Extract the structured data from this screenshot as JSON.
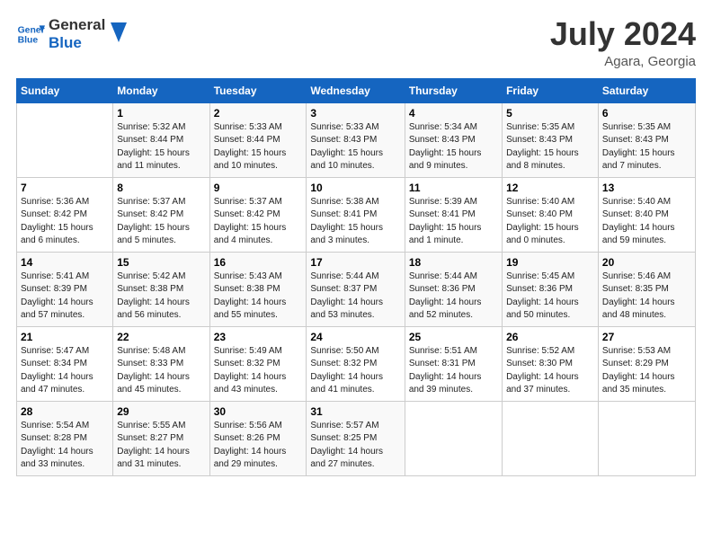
{
  "header": {
    "logo_line1": "General",
    "logo_line2": "Blue",
    "month": "July 2024",
    "location": "Agara, Georgia"
  },
  "days_of_week": [
    "Sunday",
    "Monday",
    "Tuesday",
    "Wednesday",
    "Thursday",
    "Friday",
    "Saturday"
  ],
  "weeks": [
    [
      {
        "day": "",
        "info": ""
      },
      {
        "day": "1",
        "info": "Sunrise: 5:32 AM\nSunset: 8:44 PM\nDaylight: 15 hours\nand 11 minutes."
      },
      {
        "day": "2",
        "info": "Sunrise: 5:33 AM\nSunset: 8:44 PM\nDaylight: 15 hours\nand 10 minutes."
      },
      {
        "day": "3",
        "info": "Sunrise: 5:33 AM\nSunset: 8:43 PM\nDaylight: 15 hours\nand 10 minutes."
      },
      {
        "day": "4",
        "info": "Sunrise: 5:34 AM\nSunset: 8:43 PM\nDaylight: 15 hours\nand 9 minutes."
      },
      {
        "day": "5",
        "info": "Sunrise: 5:35 AM\nSunset: 8:43 PM\nDaylight: 15 hours\nand 8 minutes."
      },
      {
        "day": "6",
        "info": "Sunrise: 5:35 AM\nSunset: 8:43 PM\nDaylight: 15 hours\nand 7 minutes."
      }
    ],
    [
      {
        "day": "7",
        "info": "Sunrise: 5:36 AM\nSunset: 8:42 PM\nDaylight: 15 hours\nand 6 minutes."
      },
      {
        "day": "8",
        "info": "Sunrise: 5:37 AM\nSunset: 8:42 PM\nDaylight: 15 hours\nand 5 minutes."
      },
      {
        "day": "9",
        "info": "Sunrise: 5:37 AM\nSunset: 8:42 PM\nDaylight: 15 hours\nand 4 minutes."
      },
      {
        "day": "10",
        "info": "Sunrise: 5:38 AM\nSunset: 8:41 PM\nDaylight: 15 hours\nand 3 minutes."
      },
      {
        "day": "11",
        "info": "Sunrise: 5:39 AM\nSunset: 8:41 PM\nDaylight: 15 hours\nand 1 minute."
      },
      {
        "day": "12",
        "info": "Sunrise: 5:40 AM\nSunset: 8:40 PM\nDaylight: 15 hours\nand 0 minutes."
      },
      {
        "day": "13",
        "info": "Sunrise: 5:40 AM\nSunset: 8:40 PM\nDaylight: 14 hours\nand 59 minutes."
      }
    ],
    [
      {
        "day": "14",
        "info": "Sunrise: 5:41 AM\nSunset: 8:39 PM\nDaylight: 14 hours\nand 57 minutes."
      },
      {
        "day": "15",
        "info": "Sunrise: 5:42 AM\nSunset: 8:38 PM\nDaylight: 14 hours\nand 56 minutes."
      },
      {
        "day": "16",
        "info": "Sunrise: 5:43 AM\nSunset: 8:38 PM\nDaylight: 14 hours\nand 55 minutes."
      },
      {
        "day": "17",
        "info": "Sunrise: 5:44 AM\nSunset: 8:37 PM\nDaylight: 14 hours\nand 53 minutes."
      },
      {
        "day": "18",
        "info": "Sunrise: 5:44 AM\nSunset: 8:36 PM\nDaylight: 14 hours\nand 52 minutes."
      },
      {
        "day": "19",
        "info": "Sunrise: 5:45 AM\nSunset: 8:36 PM\nDaylight: 14 hours\nand 50 minutes."
      },
      {
        "day": "20",
        "info": "Sunrise: 5:46 AM\nSunset: 8:35 PM\nDaylight: 14 hours\nand 48 minutes."
      }
    ],
    [
      {
        "day": "21",
        "info": "Sunrise: 5:47 AM\nSunset: 8:34 PM\nDaylight: 14 hours\nand 47 minutes."
      },
      {
        "day": "22",
        "info": "Sunrise: 5:48 AM\nSunset: 8:33 PM\nDaylight: 14 hours\nand 45 minutes."
      },
      {
        "day": "23",
        "info": "Sunrise: 5:49 AM\nSunset: 8:32 PM\nDaylight: 14 hours\nand 43 minutes."
      },
      {
        "day": "24",
        "info": "Sunrise: 5:50 AM\nSunset: 8:32 PM\nDaylight: 14 hours\nand 41 minutes."
      },
      {
        "day": "25",
        "info": "Sunrise: 5:51 AM\nSunset: 8:31 PM\nDaylight: 14 hours\nand 39 minutes."
      },
      {
        "day": "26",
        "info": "Sunrise: 5:52 AM\nSunset: 8:30 PM\nDaylight: 14 hours\nand 37 minutes."
      },
      {
        "day": "27",
        "info": "Sunrise: 5:53 AM\nSunset: 8:29 PM\nDaylight: 14 hours\nand 35 minutes."
      }
    ],
    [
      {
        "day": "28",
        "info": "Sunrise: 5:54 AM\nSunset: 8:28 PM\nDaylight: 14 hours\nand 33 minutes."
      },
      {
        "day": "29",
        "info": "Sunrise: 5:55 AM\nSunset: 8:27 PM\nDaylight: 14 hours\nand 31 minutes."
      },
      {
        "day": "30",
        "info": "Sunrise: 5:56 AM\nSunset: 8:26 PM\nDaylight: 14 hours\nand 29 minutes."
      },
      {
        "day": "31",
        "info": "Sunrise: 5:57 AM\nSunset: 8:25 PM\nDaylight: 14 hours\nand 27 minutes."
      },
      {
        "day": "",
        "info": ""
      },
      {
        "day": "",
        "info": ""
      },
      {
        "day": "",
        "info": ""
      }
    ]
  ]
}
